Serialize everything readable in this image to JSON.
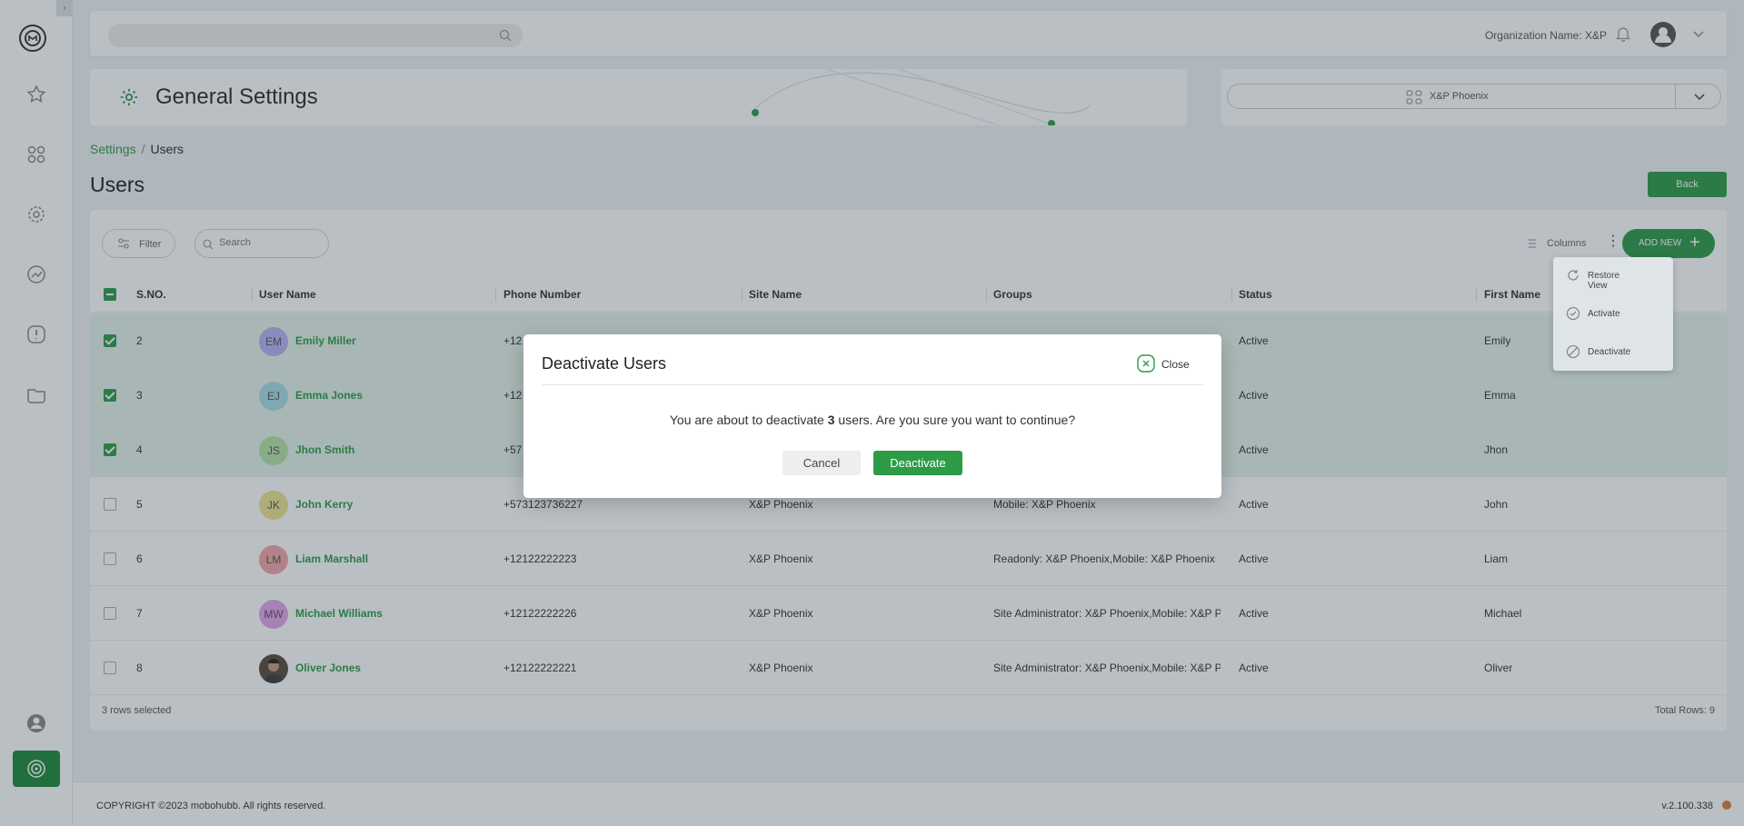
{
  "topbar": {
    "search_placeholder": "",
    "org_label": "Organization Name: X&P"
  },
  "header": {
    "title": "General Settings"
  },
  "site_selector": {
    "value": "X&P Phoenix"
  },
  "breadcrumb": {
    "root": "Settings",
    "sep": "/",
    "current": "Users"
  },
  "page": {
    "title": "Users",
    "back_label": "Back"
  },
  "toolbar": {
    "filter_label": "Filter",
    "search_placeholder": "Search",
    "columns_label": "Columns",
    "add_new_label": "ADD NEW"
  },
  "table": {
    "headers": [
      "S.NO.",
      "User Name",
      "Phone Number",
      "Site Name",
      "Groups",
      "Status",
      "First Name"
    ],
    "rows": [
      {
        "selected": true,
        "sno": "2",
        "initials": "EM",
        "name": "Emily Miller",
        "phone": "+12",
        "site": "",
        "groups": "",
        "status": "Active",
        "first": "Emily"
      },
      {
        "selected": true,
        "sno": "3",
        "initials": "EJ",
        "name": "Emma Jones",
        "phone": "+12",
        "site": "",
        "groups": "",
        "status": "Active",
        "first": "Emma"
      },
      {
        "selected": true,
        "sno": "4",
        "initials": "JS",
        "name": "Jhon Smith",
        "phone": "+57",
        "site": "",
        "groups": "",
        "status": "Active",
        "first": "Jhon"
      },
      {
        "selected": false,
        "sno": "5",
        "initials": "JK",
        "name": "John Kerry",
        "phone": "+573123736227",
        "site": "X&P Phoenix",
        "groups": "Mobile: X&P Phoenix",
        "status": "Active",
        "first": "John"
      },
      {
        "selected": false,
        "sno": "6",
        "initials": "LM",
        "name": "Liam Marshall",
        "phone": "+12122222223",
        "site": "X&P Phoenix",
        "groups": "Readonly: X&P Phoenix,Mobile: X&P Phoenix",
        "status": "Active",
        "first": "Liam"
      },
      {
        "selected": false,
        "sno": "7",
        "initials": "MW",
        "name": "Michael Williams",
        "phone": "+12122222226",
        "site": "X&P Phoenix",
        "groups": "Site Administrator: X&P Phoenix,Mobile: X&P P...",
        "status": "Active",
        "first": "Michael"
      },
      {
        "selected": false,
        "sno": "8",
        "initials": "",
        "name": "Oliver Jones",
        "phone": "+12122222221",
        "site": "X&P Phoenix",
        "groups": "Site Administrator: X&P Phoenix,Mobile: X&P P...",
        "status": "Active",
        "first": "Oliver"
      }
    ],
    "rows_selected": "3 rows selected",
    "total_rows": "Total Rows: 9"
  },
  "menu": {
    "items": [
      "Restore View",
      "Activate",
      "Deactivate"
    ]
  },
  "modal": {
    "title": "Deactivate Users",
    "close_label": "Close",
    "msg_before": "You are about to deactivate ",
    "count": "3",
    "msg_after": " users. Are you sure you want to continue?",
    "cancel_label": "Cancel",
    "confirm_label": "Deactivate"
  },
  "footer": {
    "copyright": "COPYRIGHT ©2023 mobohubb. All rights reserved.",
    "version": "v.2.100.338"
  },
  "colors": {
    "accent": "#2e9b47",
    "avatar_em": "#b7b3f0",
    "avatar_ej": "#a8dde3",
    "avatar_js": "#b6e3a6",
    "avatar_jk": "#efe48e",
    "avatar_lm": "#f2a5a5",
    "avatar_mw": "#e3a6ea"
  }
}
